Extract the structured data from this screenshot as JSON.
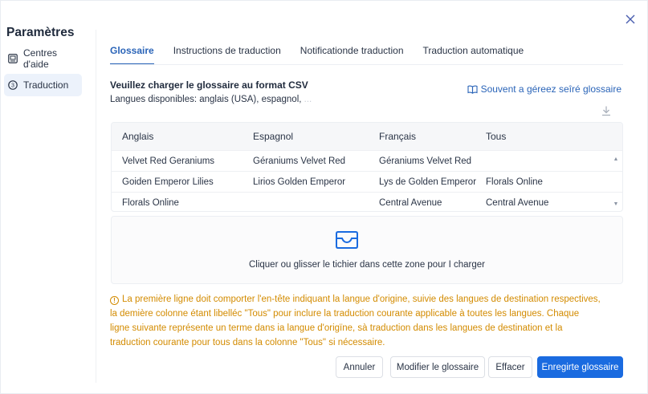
{
  "sidebar": {
    "title": "Paramètres",
    "items": [
      {
        "label": "Centres d'aide",
        "icon": "grid-icon"
      },
      {
        "label": "Traduction",
        "icon": "circle-number-icon"
      }
    ]
  },
  "tabs": [
    {
      "label": "Glossaire",
      "active": true
    },
    {
      "label": "Instructions de traduction",
      "active": false
    },
    {
      "label": "Notificationde traduction",
      "active": false
    },
    {
      "label": "Traduction automatique",
      "active": false
    }
  ],
  "main": {
    "heading": "Veuillez charger le glossaire au format CSV",
    "languages_label": "Langues disponibles: anglais (USA), espagnol,",
    "languages_faded": "...",
    "help_link": "Souvent a géreez seîré glossaire"
  },
  "table": {
    "columns": [
      "Anglais",
      "Espagnol",
      "Français",
      "Tous"
    ],
    "rows": [
      [
        "Velvet Red Geraniums",
        "Géraniums Velvet Red",
        "Géraniums Velvet Red",
        ""
      ],
      [
        "Goiden Emperor Lilies",
        "Lirios Golden Emperor",
        "Lys de Golden Emperor",
        "Florals Online"
      ],
      [
        "Florals Online",
        "",
        "Central Avenue",
        "Central Avenue"
      ]
    ]
  },
  "dropzone": {
    "text": "Cliquer ou glisser le tichier dans cette zone pour I charger"
  },
  "notice": {
    "lines": [
      "La première ligne doit comporter l'en-tête indiquant la langue d'origine, suivie des langues de destination respectives,",
      "la demière colonne étant libelléc \"Tous\" pour inclure la traduction courante applicable à toutes les langues. Chaque",
      "ligne suivante représente un terme dans ia langue d'origïne, sà traduction dans les langues de destination et la",
      "traduction courante pour tous dans la colonne \"Tous\" si nécessaire."
    ]
  },
  "buttons": {
    "cancel": "Annuler",
    "edit": "Modifier le glossaire",
    "clear": "Effacer",
    "save": "Enregirte glossaire"
  },
  "colors": {
    "accent": "#2a64b8",
    "primary_button": "#1a6be0",
    "warning": "#d38b00"
  }
}
